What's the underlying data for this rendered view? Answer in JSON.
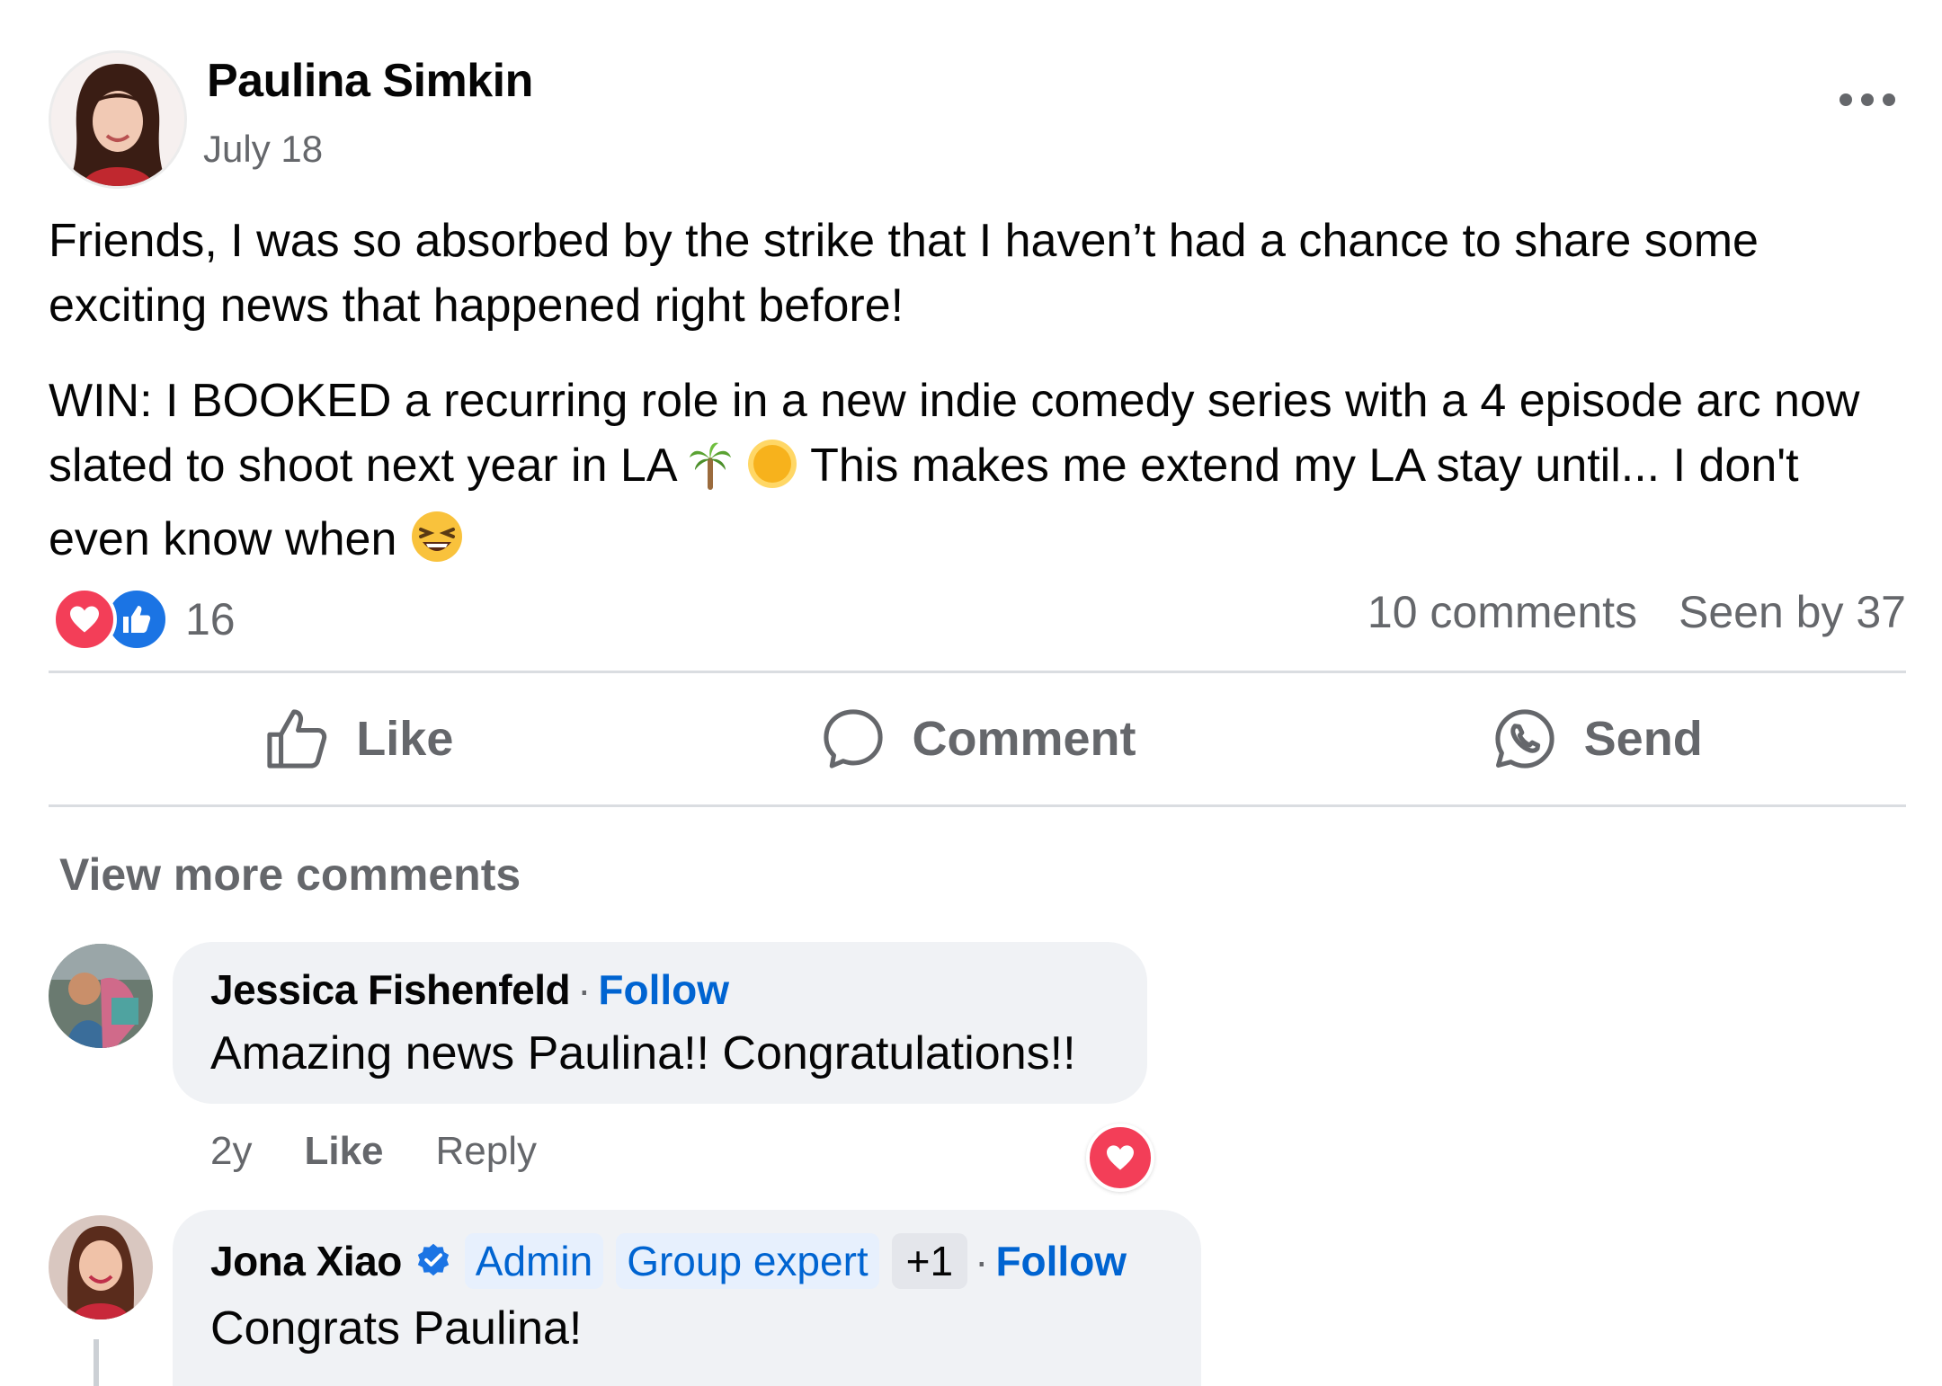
{
  "post": {
    "author": "Paulina Simkin",
    "date": "July 18",
    "paragraph1": "Friends, I was so absorbed by the strike that I haven’t had a chance to share some exciting news that happened right before!",
    "paragraph2_a": "WIN: I BOOKED a recurring role in a new indie comedy series with a 4 episode arc now slated to shoot next year in LA",
    "paragraph2_b": "This makes me extend my LA stay until... I don't even know when",
    "reaction_count": "16",
    "comments_count": "10 comments",
    "seen_by": "Seen by 37"
  },
  "actions": {
    "like": "Like",
    "comment": "Comment",
    "send": "Send"
  },
  "view_more_comments": "View more comments",
  "comments": [
    {
      "name": "Jessica Fishenfeld",
      "separator": "·",
      "follow": "Follow",
      "text": "Amazing news Paulina!! Congratulations!!",
      "age": "2y",
      "like": "Like",
      "reply": "Reply"
    },
    {
      "name": "Jona Xiao",
      "badge1": "Admin",
      "badge2": "Group expert",
      "extra_badges": "+1",
      "separator": "·",
      "follow": "Follow",
      "text": "Congrats Paulina!"
    }
  ],
  "colors": {
    "accent_blue": "#0064d1",
    "like_blue": "#1b74e4",
    "love_red": "#f33e58",
    "muted": "#65676b",
    "bubble_bg": "#f0f2f5"
  },
  "icons": [
    "more-options-icon",
    "love-reaction-icon",
    "like-reaction-icon",
    "thumbs-up-icon",
    "comment-bubble-icon",
    "whatsapp-send-icon",
    "verified-badge-icon",
    "palm-tree-emoji",
    "sun-emoji",
    "laughing-emoji"
  ]
}
